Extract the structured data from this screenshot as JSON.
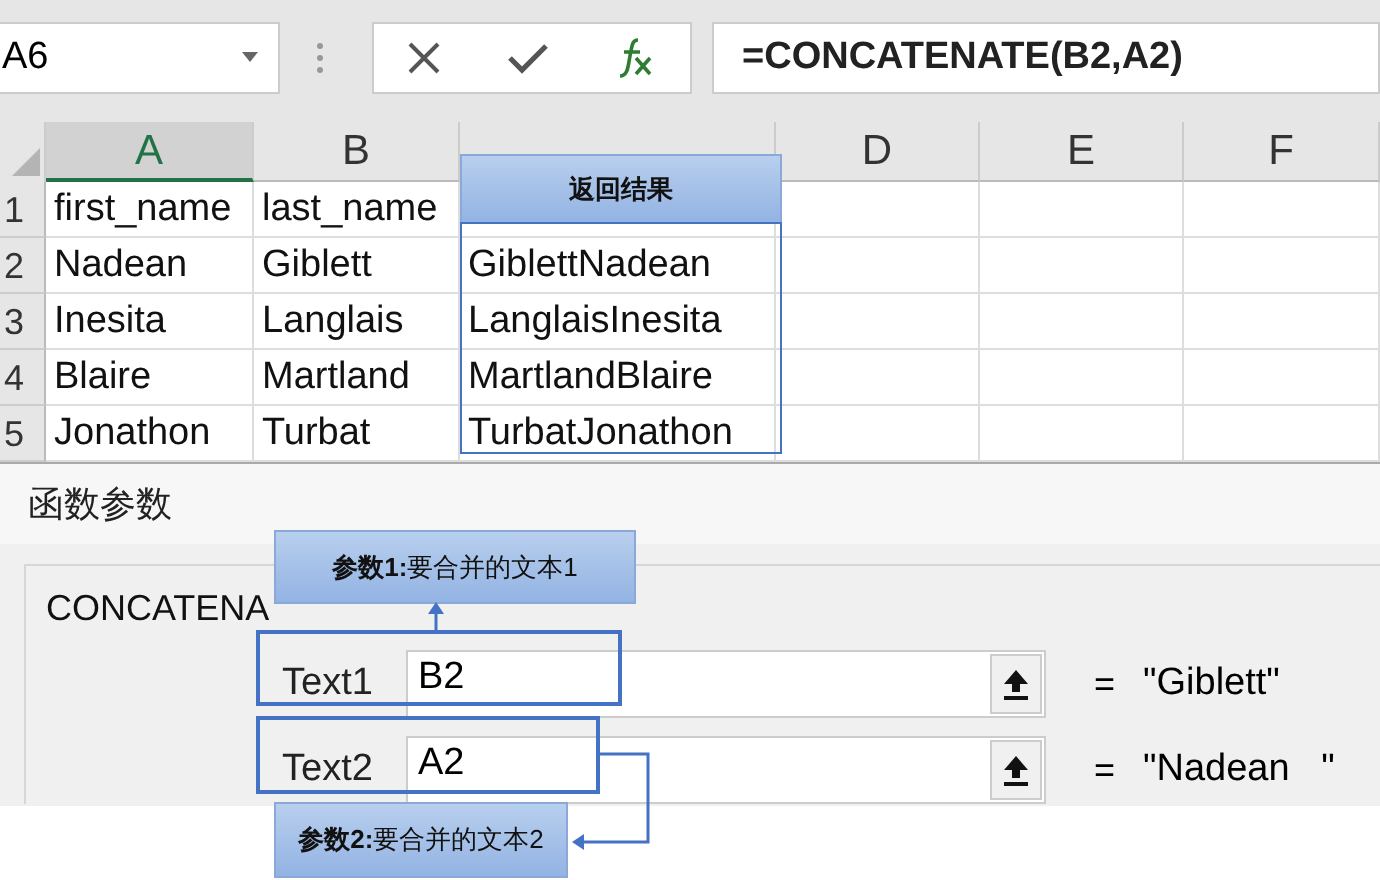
{
  "name_box": {
    "value": "A6"
  },
  "formula_bar": {
    "formula": "=CONCATENATE(B2,A2)"
  },
  "sheet": {
    "columns": [
      {
        "label": "A",
        "selected": true
      },
      {
        "label": "B",
        "selected": false
      },
      {
        "selected": false
      },
      {
        "label": "D",
        "selected": false
      },
      {
        "label": "E",
        "selected": false
      },
      {
        "label": "F",
        "selected": false
      }
    ],
    "rows": [
      {
        "number": "1",
        "cells": [
          "first_name",
          "last_name"
        ]
      },
      {
        "number": "2",
        "cells": [
          "Nadean",
          "Giblett",
          "GiblettNadean"
        ]
      },
      {
        "number": "3",
        "cells": [
          "Inesita",
          "Langlais",
          "LanglaisInesita"
        ]
      },
      {
        "number": "4",
        "cells": [
          "Blaire",
          "Martland",
          "MartlandBlaire"
        ]
      },
      {
        "number": "5",
        "cells": [
          "Jonathon",
          "Turbat",
          "TurbatJonathon"
        ]
      }
    ]
  },
  "dialog": {
    "title": "函数参数",
    "function_name": "CONCATENA",
    "arguments": [
      {
        "label": "Text1",
        "value": "B2",
        "equals": "=",
        "result": "\"Giblett\""
      },
      {
        "label": "Text2",
        "value": "A2",
        "equals": "=",
        "result": "\"Nadean   \""
      }
    ]
  },
  "annotations": {
    "result_callout": "返回结果",
    "argument_callouts": [
      "**参数1:**要合并的文本1",
      "**参数2:**要合并的文本2"
    ]
  }
}
